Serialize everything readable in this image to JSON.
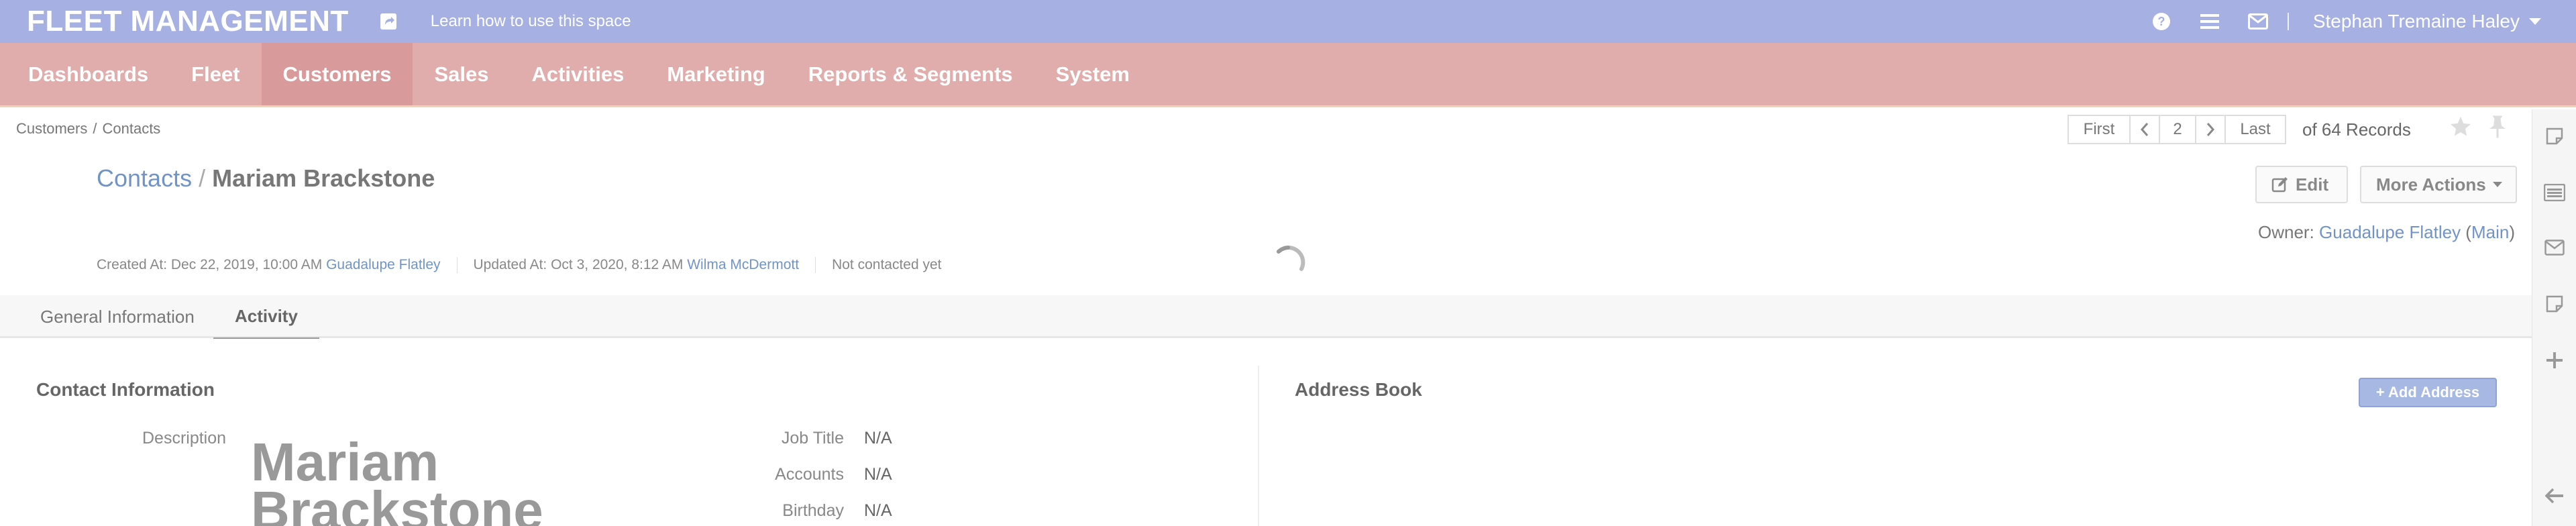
{
  "topbar": {
    "app_title": "FLEET MANAGEMENT",
    "share_icon": "share-icon",
    "learn_link": "Learn how to use this space",
    "icons": [
      "help-icon",
      "list-icon",
      "mail-icon"
    ],
    "user_name": "Stephan Tremaine Haley"
  },
  "nav": {
    "items": [
      {
        "label": "Dashboards"
      },
      {
        "label": "Fleet"
      },
      {
        "label": "Customers"
      },
      {
        "label": "Sales"
      },
      {
        "label": "Activities"
      },
      {
        "label": "Marketing"
      },
      {
        "label": "Reports & Segments"
      },
      {
        "label": "System"
      }
    ],
    "active": "Customers"
  },
  "breadcrumb": {
    "parent": "Customers",
    "separator": "/",
    "current": "Contacts"
  },
  "pager": {
    "first": "First",
    "page": "2",
    "last": "Last",
    "records": "of 64 Records"
  },
  "page": {
    "parent_title": "Contacts",
    "separator": "/",
    "title": "Mariam Brackstone",
    "edit_label": "Edit",
    "more_actions_label": "More Actions",
    "owner_label": "Owner:",
    "owner_name": "Guadalupe Flatley",
    "owner_unit": "Main",
    "created_label": "Created At: Dec 22, 2019, 10:00 AM",
    "created_by": "Guadalupe Flatley",
    "updated_label": "Updated At: Oct 3, 2020, 8:12 AM",
    "updated_by": "Wilma McDermott",
    "contacted": "Not contacted yet"
  },
  "tabs": [
    {
      "label": "General Information"
    },
    {
      "label": "Activity"
    }
  ],
  "contact_info": {
    "title": "Contact Information",
    "description_label": "Description",
    "name_display_line1": "Mariam",
    "name_display_line2": "Brackstone",
    "job_title_label": "Job Title",
    "job_title_value": "N/A",
    "accounts_label": "Accounts",
    "accounts_value": "N/A",
    "birthday_label": "Birthday",
    "birthday_value": "N/A"
  },
  "address_book": {
    "title": "Address Book",
    "add_label": "+ Add Address"
  },
  "sidepanel": {
    "icons": [
      "note-icon",
      "list-panel-icon",
      "mail-icon",
      "note-icon",
      "plus-icon",
      "arrow-left-icon"
    ]
  },
  "colors": {
    "topbar": "#a7b0e3",
    "nav": "#e0acac",
    "nav_active": "#d89a9a",
    "link": "#7193c8"
  }
}
